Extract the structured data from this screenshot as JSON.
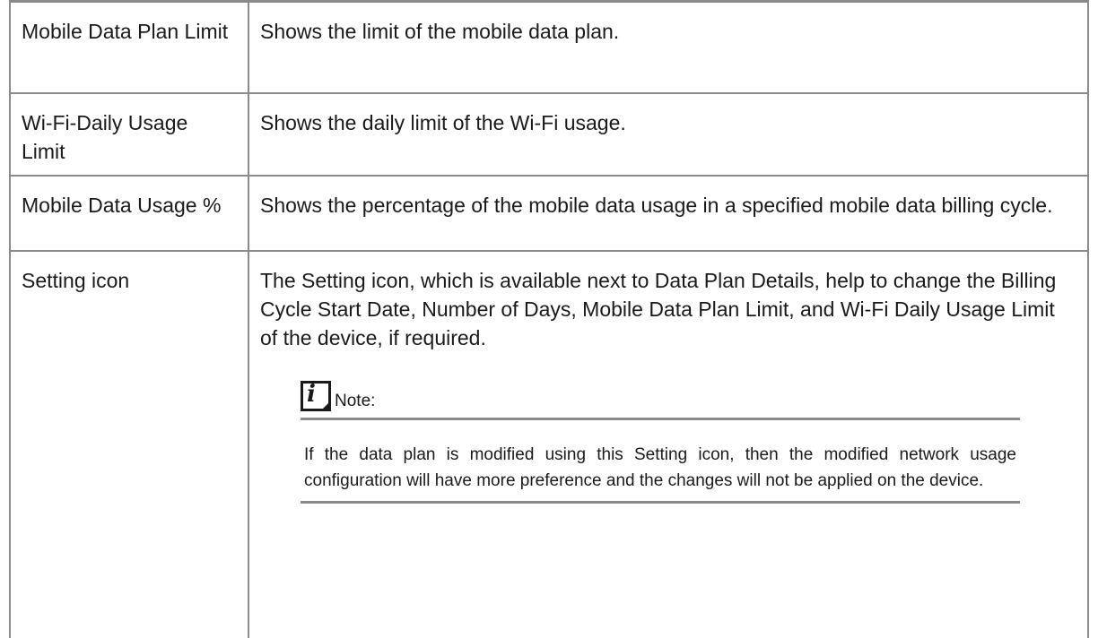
{
  "rows": [
    {
      "term": "Mobile Data Plan Limit",
      "description": "Shows the limit of the mobile data plan."
    },
    {
      "term": "Wi-Fi-Daily Usage Limit",
      "description": "Shows the daily limit of the Wi-Fi usage."
    },
    {
      "term": "Mobile Data Usage %",
      "description": "Shows the percentage of the mobile data usage in a specified mobile data billing cycle."
    },
    {
      "term": "Setting icon",
      "description": "The Setting icon, which is available next to Data Plan Details, help to change the Billing Cycle Start Date, Number of Days, Mobile Data Plan Limit, and Wi-Fi Daily Usage Limit of the device, if required."
    }
  ],
  "note": {
    "icon": "info-note-icon",
    "label": "Note:",
    "text": "If the data plan is modified using this Setting icon, then the modified network usage configuration will have more preference and the changes will not be applied on the device."
  }
}
